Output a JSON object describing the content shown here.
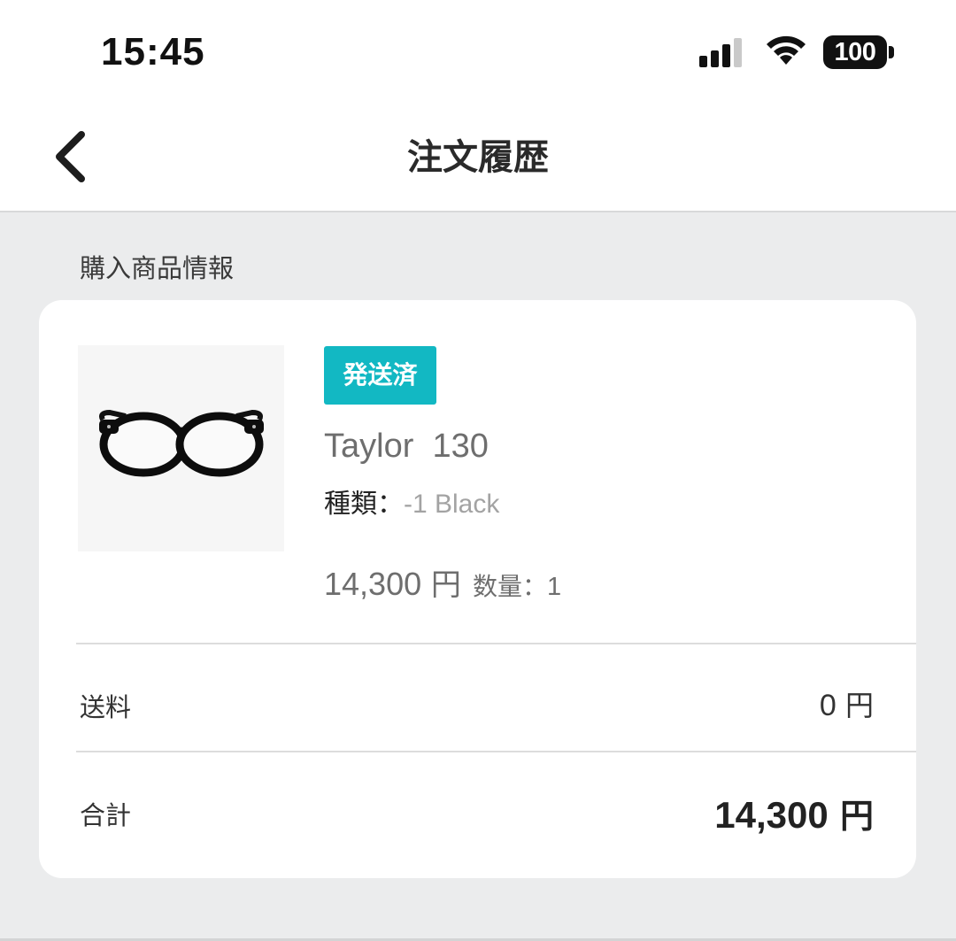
{
  "status_bar": {
    "time": "15:45",
    "battery": "100",
    "icons": [
      "cellular-signal-icon",
      "wifi-icon",
      "battery-icon"
    ]
  },
  "nav": {
    "back_icon": "chevron-left-icon",
    "title": "注文履歴"
  },
  "section": {
    "label": "購入商品情報"
  },
  "product": {
    "image": "eyeglasses-product-image",
    "status": "発送済",
    "status_color": "#12b8c3",
    "name": "Taylor  130",
    "variant_label": "種類：",
    "variant_value": "-1 Black",
    "price": "14,300",
    "price_unit": " 円",
    "quantity_label": "数量：",
    "quantity": "1"
  },
  "summary": {
    "shipping_label": "送料",
    "shipping_amount": "0",
    "shipping_unit": " 円",
    "total_label": "合計",
    "total_amount": "14,300",
    "total_unit": " 円"
  }
}
